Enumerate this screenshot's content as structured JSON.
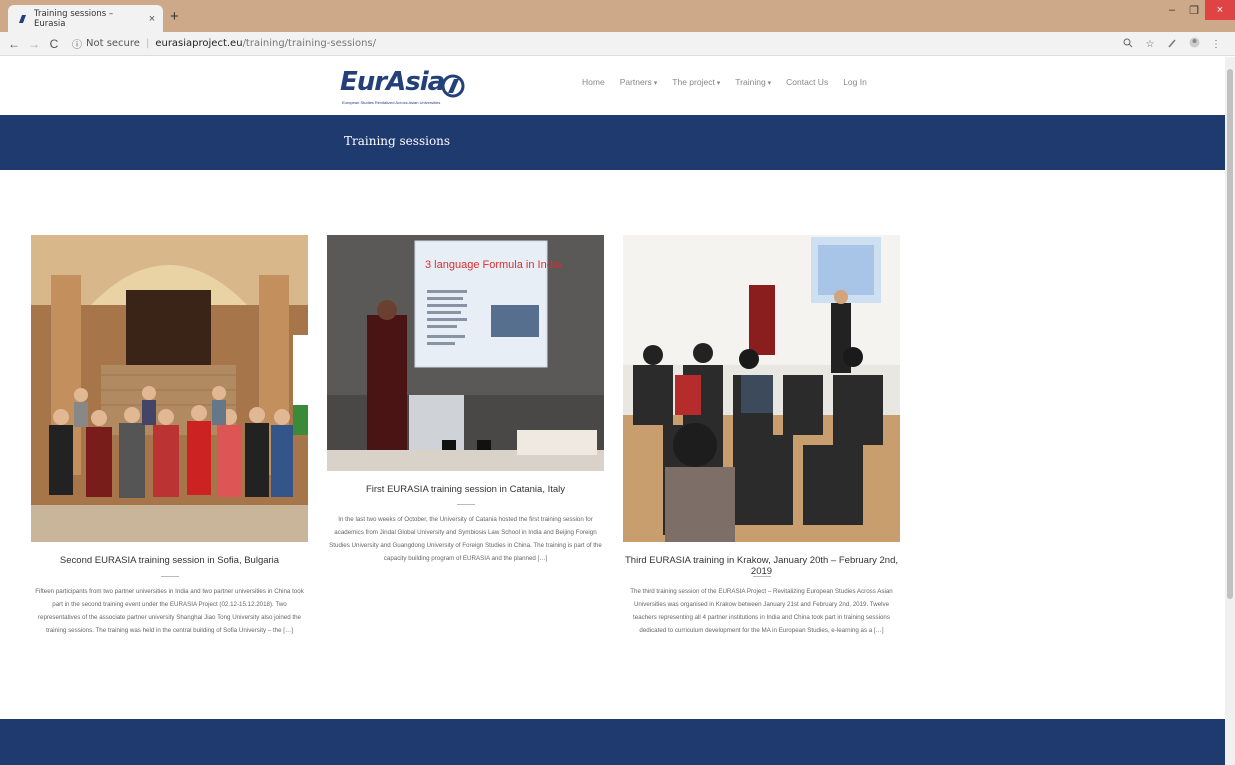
{
  "browser": {
    "tab_title": "Training sessions – Eurasia",
    "tab_close": "×",
    "new_tab": "+",
    "not_secure": "Not secure",
    "url_host": "eurasiaproject.eu",
    "url_path": "/training/training-sessions/",
    "window_controls": [
      "–",
      "❐",
      "×"
    ]
  },
  "site": {
    "logo_text": "EurAsia",
    "logo_tagline": "European Studies Revitalized Across Asian Universities",
    "menu": [
      "Home",
      "Partners",
      "The project",
      "Training",
      "Contact Us",
      "Log In"
    ]
  },
  "page_title": "Training sessions",
  "posts": [
    {
      "title": "Second EURASIA training session in Sofia, Bulgaria",
      "excerpt": "Fifteen participants from two partner universities in India and two partner universities in China took part in the second training event under the EURASIA Project (02.12-15.12.2018). Two representatives of the associate partner university Shanghai Jiao Tong University also joined the training sessions. The training was held in the central building of Sofia University – the […]"
    },
    {
      "title": "First EURASIA training session in Catania, Italy",
      "excerpt": "In the last two weeks of October, the University of Catania hosted the first training session for academics from Jindal Global University and Symbiosis Law School in India and Beijing Foreign Studies University and Guangdong University of Foreign Studies in China. The training is part of the capacity building program of EURASIA and the planned […]",
      "slide_title": "3 language Formula in India"
    },
    {
      "title": "Third EURASIA training in Krakow, January 20th – February 2nd, 2019",
      "excerpt": "The third training session of the EURASIA Project – Revitalizing European Studies Across Asian Universities was organised in Krakow between January 21st and February 2nd, 2019. Twelve teachers representing all 4 partner institutions in India and China took part in training sessions dedicated to curriculum development for the MA in European Studies, e-learning as a […]"
    }
  ]
}
